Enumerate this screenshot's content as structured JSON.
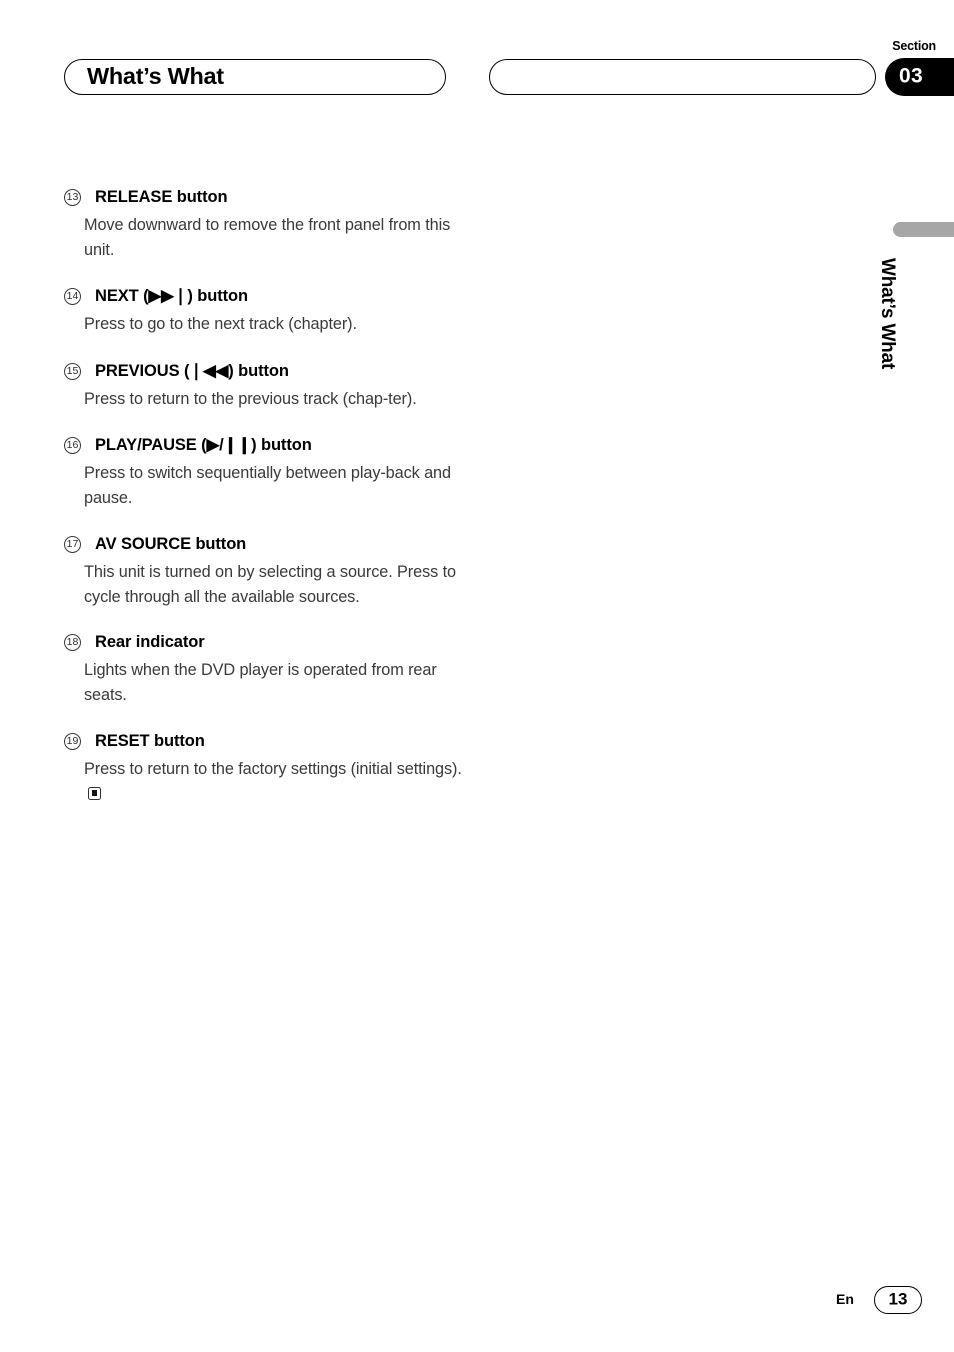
{
  "header": {
    "title": "What’s What",
    "subtitle": "",
    "section_label": "Section",
    "section_number": "03"
  },
  "side_tab": {
    "label": "What’s What",
    "bar_color": "#a6a6a6"
  },
  "content": {
    "entries": [
      {
        "number": "13",
        "heading": "RELEASE button",
        "body": "Move downward to remove the front panel from this unit."
      },
      {
        "number": "14",
        "heading": "NEXT (▶▶❘) button",
        "body": "Press to go to the next track (chapter)."
      },
      {
        "number": "15",
        "heading": "PREVIOUS (❘◀◀) button",
        "body": "Press to return to the previous track (chap-ter)."
      },
      {
        "number": "16",
        "heading": "PLAY/PAUSE (▶/❙❙) button",
        "body": "Press to switch sequentially between play-back and pause."
      },
      {
        "number": "17",
        "heading": "AV SOURCE button",
        "body": "This unit is turned on by selecting a source. Press to cycle through all the available sources."
      },
      {
        "number": "18",
        "heading": "Rear indicator",
        "body": "Lights when the DVD player is operated from rear seats."
      },
      {
        "number": "19",
        "heading": "RESET button",
        "body": "Press to return to the factory settings (initial settings)."
      }
    ]
  },
  "footer": {
    "language": "En",
    "page_number": "13"
  }
}
